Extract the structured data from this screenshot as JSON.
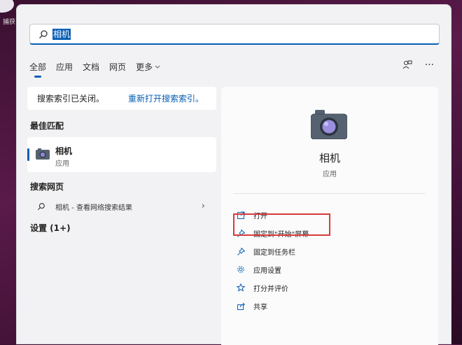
{
  "desktop": {
    "icon_label": "捕获"
  },
  "search": {
    "query": "相机"
  },
  "tabs": [
    {
      "label": "全部"
    },
    {
      "label": "应用"
    },
    {
      "label": "文档"
    },
    {
      "label": "网页"
    },
    {
      "label": "更多"
    }
  ],
  "toolbar": {
    "more_label": "···"
  },
  "notice": {
    "text": "搜索索引已关闭。",
    "link": "重新打开搜索索引。"
  },
  "best_match": {
    "title": "最佳匹配",
    "name": "相机",
    "type": "应用"
  },
  "web_search": {
    "title": "搜索网页",
    "text": "相机 - 查看网络搜索结果"
  },
  "settings": {
    "title": "设置 (1+)"
  },
  "detail": {
    "name": "相机",
    "type": "应用",
    "actions": [
      {
        "label": "打开",
        "icon": "open-icon"
      },
      {
        "label": "固定到\"开始\"屏幕",
        "icon": "pin-icon"
      },
      {
        "label": "固定到任务栏",
        "icon": "pin-icon"
      },
      {
        "label": "应用设置",
        "icon": "gear-icon"
      },
      {
        "label": "打分并评价",
        "icon": "star-icon"
      },
      {
        "label": "共享",
        "icon": "share-icon"
      }
    ]
  },
  "colors": {
    "accent": "#0a5fb4",
    "highlight": "#d93a3a"
  }
}
